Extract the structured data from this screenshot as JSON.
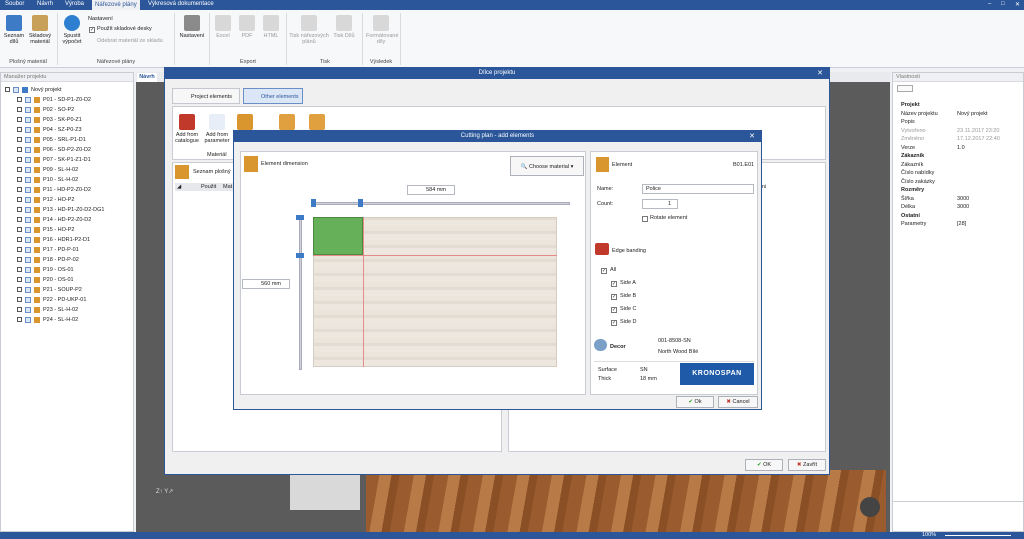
{
  "menu": {
    "items": [
      "Soubor",
      "Návrh",
      "Výroba",
      "Nářezové plány",
      "Výkresová dokumentace"
    ],
    "active": "Nářezové plány"
  },
  "ribbon": {
    "seznam_dilu": "Seznam dílů",
    "skladovy_material": "Skladový materiál",
    "spustit_vypocet": "Spustit výpočet",
    "nastaveni_small": "Nastavení",
    "pouzit_skladove": "Použít skladové desky",
    "odebrat": "Odebrat materiál ze skladu",
    "nastaveni": "Nastavení",
    "excel": "Excel",
    "pdf": "PDF",
    "html": "HTML",
    "tisk_planu": "Tisk nářezových plánů",
    "tisk_dilu": "Tisk Dílů",
    "formatovane": "Formátované díly",
    "groups": {
      "plosny": "Plošný materiál",
      "narezove": "Nářezové plány",
      "export": "Export",
      "tisk": "Tisk",
      "vysledek": "Výsledek"
    }
  },
  "left_panel": {
    "title": "Manažer projektu",
    "root": "Nový projekt",
    "items": [
      "P01 - SD-P1-Z0-D2",
      "P02 - SO-P2",
      "P03 - SK-P0-Z1",
      "P04 - SZ-P0-Z3",
      "P05 - SRL-P1-D1",
      "P06 - SD-P2-Z0-D2",
      "P07 - SK-P1-Z1-D1",
      "P09 - SL-H-02",
      "P10 - SL-H-02",
      "P11 - HD-P2-Z0-D2",
      "P12 - HO-P2",
      "P13 - HD-P1-Z0-D2-DG1",
      "P14 - HD-P2-Z0-D2",
      "P15 - HO-P2",
      "P16 - HDR1-P2-D1",
      "P17 - PD-P-01",
      "P18 - PD-P-02",
      "P19 - OS-01",
      "P20 - OS-01",
      "P21 - SOUP-P2",
      "P22 - PD-UKP-01",
      "P23 - SL-H-02",
      "P24 - SL-H-02"
    ]
  },
  "center_tab": "Návrh",
  "right_panel": {
    "title": "Vlastnosti",
    "rows": [
      {
        "k": "Projekt",
        "v": "",
        "type": "head"
      },
      {
        "k": "Název projektu",
        "v": "Nový projekt",
        "type": ""
      },
      {
        "k": "Popis",
        "v": "",
        "type": ""
      },
      {
        "k": "Vytvořeno",
        "v": "23.11.2017 23:20",
        "type": "gray"
      },
      {
        "k": "Změněno",
        "v": "17.12.2017 22:40",
        "type": "gray"
      },
      {
        "k": "Verze",
        "v": "1.0",
        "type": ""
      },
      {
        "k": "Zákazník",
        "v": "",
        "type": "head"
      },
      {
        "k": "Zákazník",
        "v": "",
        "type": ""
      },
      {
        "k": "Číslo nabídky",
        "v": "",
        "type": ""
      },
      {
        "k": "Číslo zakázky",
        "v": "",
        "type": ""
      },
      {
        "k": "Rozměry",
        "v": "",
        "type": "head"
      },
      {
        "k": "Šířka",
        "v": "3000",
        "type": ""
      },
      {
        "k": "Délka",
        "v": "3000",
        "type": ""
      },
      {
        "k": "Ostatní",
        "v": "",
        "type": "head"
      },
      {
        "k": "Parametry",
        "v": "[28]",
        "type": ""
      }
    ]
  },
  "dilce": {
    "title": "Dílce projektu",
    "tab_project": "Project elements",
    "tab_other": "Other elements",
    "add_catalogue": "Add from catalogue",
    "add_parameter": "Add from parameter",
    "material": "Materiál",
    "seznam": "Seznam plošný",
    "col_pouzit": "Použit",
    "col_mat": "Mat",
    "col_reni": "řeni",
    "ok": "OK",
    "zavrit": "Zavřít"
  },
  "cutting": {
    "title": "Cutting plan - add elements",
    "element_dimension": "Element dimension",
    "choose_material": "Choose material",
    "width": "584 mm",
    "height": "560 mm",
    "element": "Element",
    "element_code": "B01.E01",
    "name_label": "Name:",
    "name_value": "Police",
    "count_label": "Count:",
    "count_value": "1",
    "rotate": "Rotate element",
    "edge_banding": "Edge banding",
    "all": "All",
    "sides": [
      "Side A",
      "Side B",
      "Side C",
      "Side D"
    ],
    "decor": "Decor",
    "decor_code": "001-8508-SN",
    "decor_name": "North Wood Bílé",
    "surface_label": "Surface",
    "surface_value": "SN",
    "thick_label": "Thick",
    "thick_value": "18 mm",
    "brand": "KRONOSPAN",
    "ok": "Ok",
    "cancel": "Cancel"
  },
  "statusbar": {
    "zoom": "100%"
  }
}
